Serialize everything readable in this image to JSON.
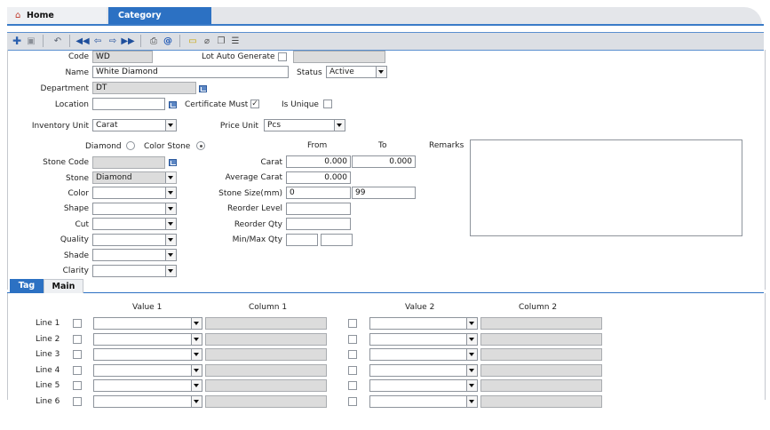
{
  "tabs": {
    "home": "Home",
    "category": "Category"
  },
  "toolbar": {
    "icons": [
      "add-icon",
      "save-icon",
      "undo-icon",
      "first-record-icon",
      "previous-record-icon",
      "next-record-icon",
      "last-record-icon",
      "print-icon",
      "email-icon",
      "note-icon",
      "attach-icon",
      "copy-icon",
      "list-icon"
    ]
  },
  "form": {
    "code_label": "Code",
    "code_value": "WD",
    "lot_auto_generate_label": "Lot Auto Generate",
    "name_label": "Name",
    "name_value": "White Diamond",
    "status_label": "Status",
    "status_value": "Active",
    "department_label": "Department",
    "department_value": "DT",
    "location_label": "Location",
    "certificate_must_label": "Certificate Must",
    "certificate_must_checked": true,
    "is_unique_label": "Is Unique",
    "inventory_unit_label": "Inventory Unit",
    "inventory_unit_value": "Carat",
    "price_unit_label": "Price Unit",
    "price_unit_value": "Pcs",
    "diamond_label": "Diamond",
    "color_stone_label": "Color Stone",
    "selected_type": "Color Stone",
    "from_label": "From",
    "to_label": "To",
    "remarks_label": "Remarks",
    "stone_code_label": "Stone Code",
    "stone_label": "Stone",
    "stone_value": "Diamond",
    "color_label": "Color",
    "shape_label": "Shape",
    "cut_label": "Cut",
    "quality_label": "Quality",
    "shade_label": "Shade",
    "clarity_label": "Clarity",
    "carat_label": "Carat",
    "carat_from": "0.000",
    "carat_to": "0.000",
    "average_carat_label": "Average Carat",
    "average_carat_value": "0.000",
    "stone_size_label": "Stone Size(mm)",
    "stone_size_from": "0",
    "stone_size_to": "99",
    "reorder_level_label": "Reorder Level",
    "reorder_qty_label": "Reorder Qty",
    "min_max_qty_label": "Min/Max Qty"
  },
  "subtabs": {
    "tag": "Tag",
    "main": "Main"
  },
  "tag_grid": {
    "value1_header": "Value 1",
    "column1_header": "Column 1",
    "value2_header": "Value 2",
    "column2_header": "Column 2",
    "lines": [
      "Line 1",
      "Line 2",
      "Line 3",
      "Line 4",
      "Line 5",
      "Line 6"
    ]
  },
  "colors": {
    "accent": "#2c71c3",
    "tabbar": "#e4e6ea",
    "disabled": "#dcdcdc"
  }
}
